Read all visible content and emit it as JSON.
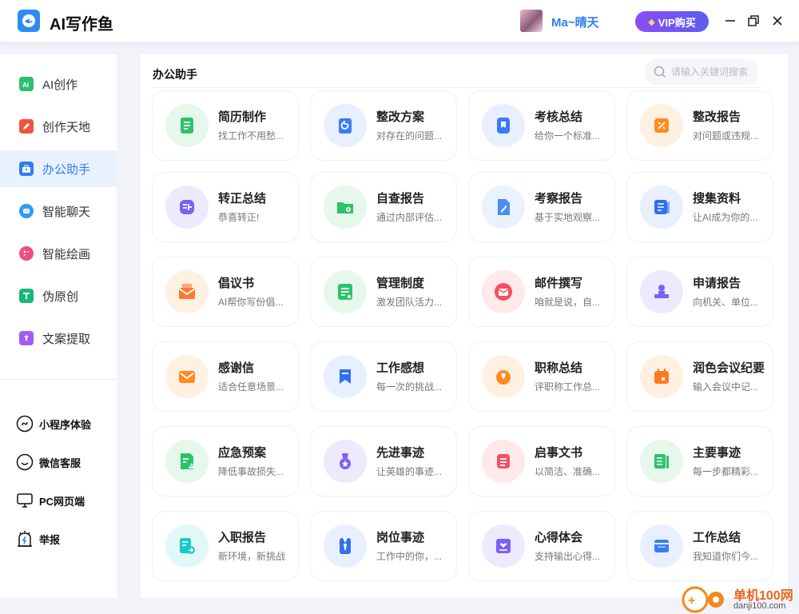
{
  "app": {
    "title": "AI写作鱼"
  },
  "user": {
    "name": "Ma~晴天"
  },
  "vip": {
    "label": "VIP购买"
  },
  "sidebar": {
    "items": [
      {
        "label": "AI创作",
        "icon": "ai-icon",
        "color": "#2dbe6c"
      },
      {
        "label": "创作天地",
        "icon": "pen-icon",
        "color": "#f0533f"
      },
      {
        "label": "办公助手",
        "icon": "briefcase-icon",
        "color": "#2f7ff0",
        "active": true
      },
      {
        "label": "智能聊天",
        "icon": "chat-icon",
        "color": "#2f9cf0"
      },
      {
        "label": "智能绘画",
        "icon": "palette-icon",
        "color": "#f04e82"
      },
      {
        "label": "伪原创",
        "icon": "text-icon",
        "color": "#17b978"
      },
      {
        "label": "文案提取",
        "icon": "extract-icon",
        "color": "#a15cf5"
      }
    ],
    "bottom": [
      {
        "label": "小程序体验",
        "icon": "mini-program-icon"
      },
      {
        "label": "微信客服",
        "icon": "wechat-service-icon"
      },
      {
        "label": "PC网页端",
        "icon": "monitor-icon"
      },
      {
        "label": "举报",
        "icon": "report-icon"
      }
    ]
  },
  "main": {
    "title": "办公助手",
    "search_placeholder": "请输入关键词搜索",
    "cards": [
      {
        "title": "简历制作",
        "desc": "找工作不用愁...",
        "icon": "resume-icon",
        "bg": "#e6f8ec",
        "fg": "#2ec26a"
      },
      {
        "title": "整改方案",
        "desc": "对存在的问题...",
        "icon": "rectify-plan-icon",
        "bg": "#e8f0ff",
        "fg": "#3a7cf5"
      },
      {
        "title": "考核总结",
        "desc": "给你一个标准...",
        "icon": "assessment-icon",
        "bg": "#e8f0ff",
        "fg": "#3a7cf5"
      },
      {
        "title": "整改报告",
        "desc": "对问题或违规...",
        "icon": "rectify-report-icon",
        "bg": "#fff1e2",
        "fg": "#ff8a1f"
      },
      {
        "title": "转正总结",
        "desc": "恭喜转正!",
        "icon": "regularization-icon",
        "bg": "#eeeafe",
        "fg": "#7b61f5"
      },
      {
        "title": "自查报告",
        "desc": "通过内部评估...",
        "icon": "self-check-icon",
        "bg": "#e6f8ec",
        "fg": "#2ec26a"
      },
      {
        "title": "考察报告",
        "desc": "基于实地观察...",
        "icon": "inspection-icon",
        "bg": "#eaf1ff",
        "fg": "#4c8bf5"
      },
      {
        "title": "搜集资料",
        "desc": "让AI成为你的...",
        "icon": "collect-icon",
        "bg": "#e8f0ff",
        "fg": "#2f6ff0"
      },
      {
        "title": "倡议书",
        "desc": "AI帮你写份倡...",
        "icon": "proposal-icon",
        "bg": "#fff1e2",
        "fg": "#ff7a30"
      },
      {
        "title": "管理制度",
        "desc": "激发团队活力...",
        "icon": "management-icon",
        "bg": "#e6f8ec",
        "fg": "#2ec26a"
      },
      {
        "title": "邮件撰写",
        "desc": "咱就是说，自...",
        "icon": "email-icon",
        "bg": "#ffe9ea",
        "fg": "#f4505f"
      },
      {
        "title": "申请报告",
        "desc": "向机关、单位...",
        "icon": "application-icon",
        "bg": "#eeeafe",
        "fg": "#7b61f5"
      },
      {
        "title": "感谢信",
        "desc": "适合任意场景...",
        "icon": "thanks-letter-icon",
        "bg": "#fff1e2",
        "fg": "#ff8a1f"
      },
      {
        "title": "工作感想",
        "desc": "每一次的挑战...",
        "icon": "work-thought-icon",
        "bg": "#e8f0ff",
        "fg": "#2f6ff0"
      },
      {
        "title": "职称总结",
        "desc": "评职称工作总...",
        "icon": "title-summary-icon",
        "bg": "#fff1e2",
        "fg": "#ff8a1f"
      },
      {
        "title": "润色会议纪要",
        "desc": "输入会议中记...",
        "icon": "meeting-minutes-icon",
        "bg": "#fff1e2",
        "fg": "#ff7a1f"
      },
      {
        "title": "应急预案",
        "desc": "降低事故损失...",
        "icon": "emergency-icon",
        "bg": "#e6f8ec",
        "fg": "#2ec26a"
      },
      {
        "title": "先进事迹",
        "desc": "让英雄的事迹...",
        "icon": "advanced-deeds-icon",
        "bg": "#eeeafe",
        "fg": "#7b61f5"
      },
      {
        "title": "启事文书",
        "desc": "以简洁、准确...",
        "icon": "notice-icon",
        "bg": "#ffe9ea",
        "fg": "#f4505f"
      },
      {
        "title": "主要事迹",
        "desc": "每一步都精彩...",
        "icon": "main-deeds-icon",
        "bg": "#e6f8ec",
        "fg": "#2ec26a"
      },
      {
        "title": "入职报告",
        "desc": "新环境，新挑战",
        "icon": "onboarding-icon",
        "bg": "#e2f8f8",
        "fg": "#1ec7c7"
      },
      {
        "title": "岗位事迹",
        "desc": "工作中的你，...",
        "icon": "post-deeds-icon",
        "bg": "#e8f0ff",
        "fg": "#2f6ff0"
      },
      {
        "title": "心得体会",
        "desc": "支持输出心得...",
        "icon": "experience-icon",
        "bg": "#eeeafe",
        "fg": "#7b61f5"
      },
      {
        "title": "工作总结",
        "desc": "我知道你们今...",
        "icon": "work-summary-icon",
        "bg": "#e8f0ff",
        "fg": "#3a7cf5"
      }
    ]
  },
  "watermark": {
    "text": "单机100网",
    "url_text": "danji100.com"
  }
}
